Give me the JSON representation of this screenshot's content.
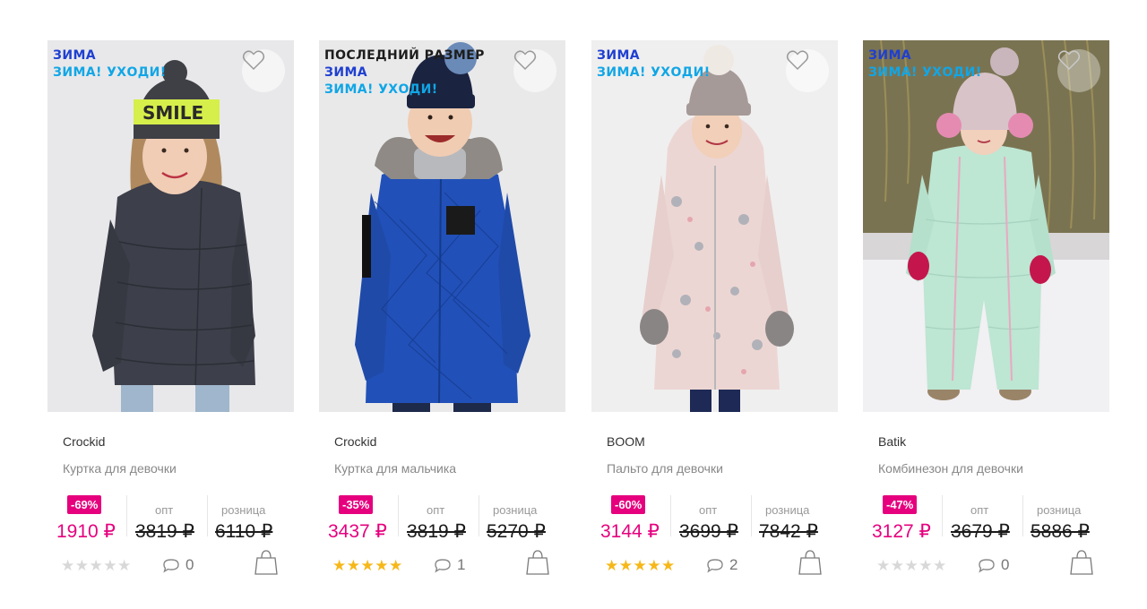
{
  "currency": "₽",
  "price_headers": {
    "wholesale": "опт",
    "retail": "розница"
  },
  "colors": {
    "accent": "#e6007e",
    "star_on": "#f6b819",
    "star_off": "#d8d8d8",
    "tag_blue": "#1f3fd1",
    "tag_cyan": "#11a6e6"
  },
  "icons": {
    "favorite": "heart-outline-icon",
    "comments": "speech-bubble-icon",
    "cart": "shopping-bag-icon",
    "rating": "star-icon"
  },
  "products": [
    {
      "tags": [
        "",
        "ЗИМА",
        "ЗИМА! УХОДИ!"
      ],
      "brand": "Crockid",
      "title": "Куртка для девочки",
      "discount": "-69%",
      "price": "1910 ₽",
      "wholesale_price": "3819 ₽",
      "retail_price": "6110 ₽",
      "rating": 0,
      "comments": "0"
    },
    {
      "tags": [
        "ПОСЛЕДНИЙ РАЗМЕР",
        "ЗИМА",
        "ЗИМА! УХОДИ!"
      ],
      "brand": "Crockid",
      "title": "Куртка для мальчика",
      "discount": "-35%",
      "price": "3437 ₽",
      "wholesale_price": "3819 ₽",
      "retail_price": "5270 ₽",
      "rating": 5,
      "comments": "1"
    },
    {
      "tags": [
        "",
        "ЗИМА",
        "ЗИМА! УХОДИ!"
      ],
      "brand": "BOOM",
      "title": "Пальто для девочки",
      "discount": "-60%",
      "price": "3144 ₽",
      "wholesale_price": "3699 ₽",
      "retail_price": "7842 ₽",
      "rating": 5,
      "comments": "2"
    },
    {
      "tags": [
        "",
        "ЗИМА",
        "ЗИМА! УХОДИ!"
      ],
      "brand": "Batik",
      "title": "Комбинезон для девочки",
      "discount": "-47%",
      "price": "3127 ₽",
      "wholesale_price": "3679 ₽",
      "retail_price": "5886 ₽",
      "rating": 0,
      "comments": "0"
    }
  ]
}
